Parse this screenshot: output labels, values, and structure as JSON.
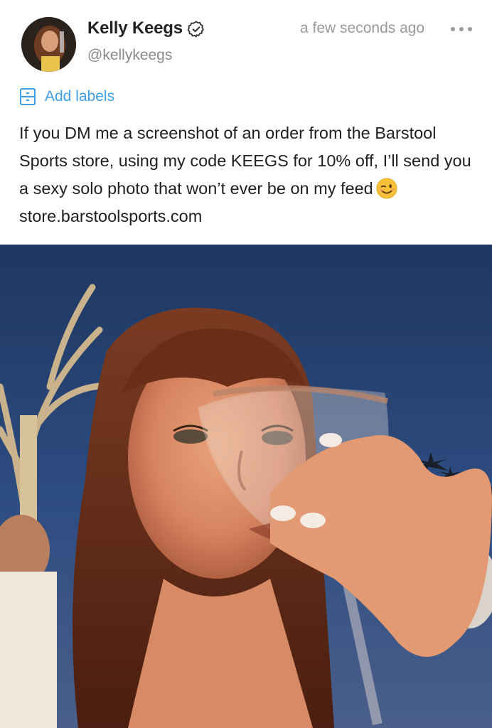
{
  "post": {
    "author": {
      "display_name": "Kelly Keegs",
      "handle": "@kellykeegs",
      "verified": true
    },
    "timestamp": "a few seconds ago",
    "labels_action": "Add labels",
    "body": {
      "text_before_emoji": "If you DM me a screenshot of an order from the Barstool Sports store, using my code KEEGS for 10% off, I’ll send you a sexy solo photo that won’t ever be on my feed",
      "emoji": "winking-face",
      "link": "store.barstoolsports.com"
    },
    "photo": {
      "description": "selfie-drinking-from-glass"
    }
  },
  "icons": {
    "verified": "verified-badge-icon",
    "more": "more-options-icon",
    "label": "label-icon"
  },
  "colors": {
    "accent": "#3f9fe0",
    "name_text": "#222222",
    "meta_text": "#9a9a9a"
  }
}
